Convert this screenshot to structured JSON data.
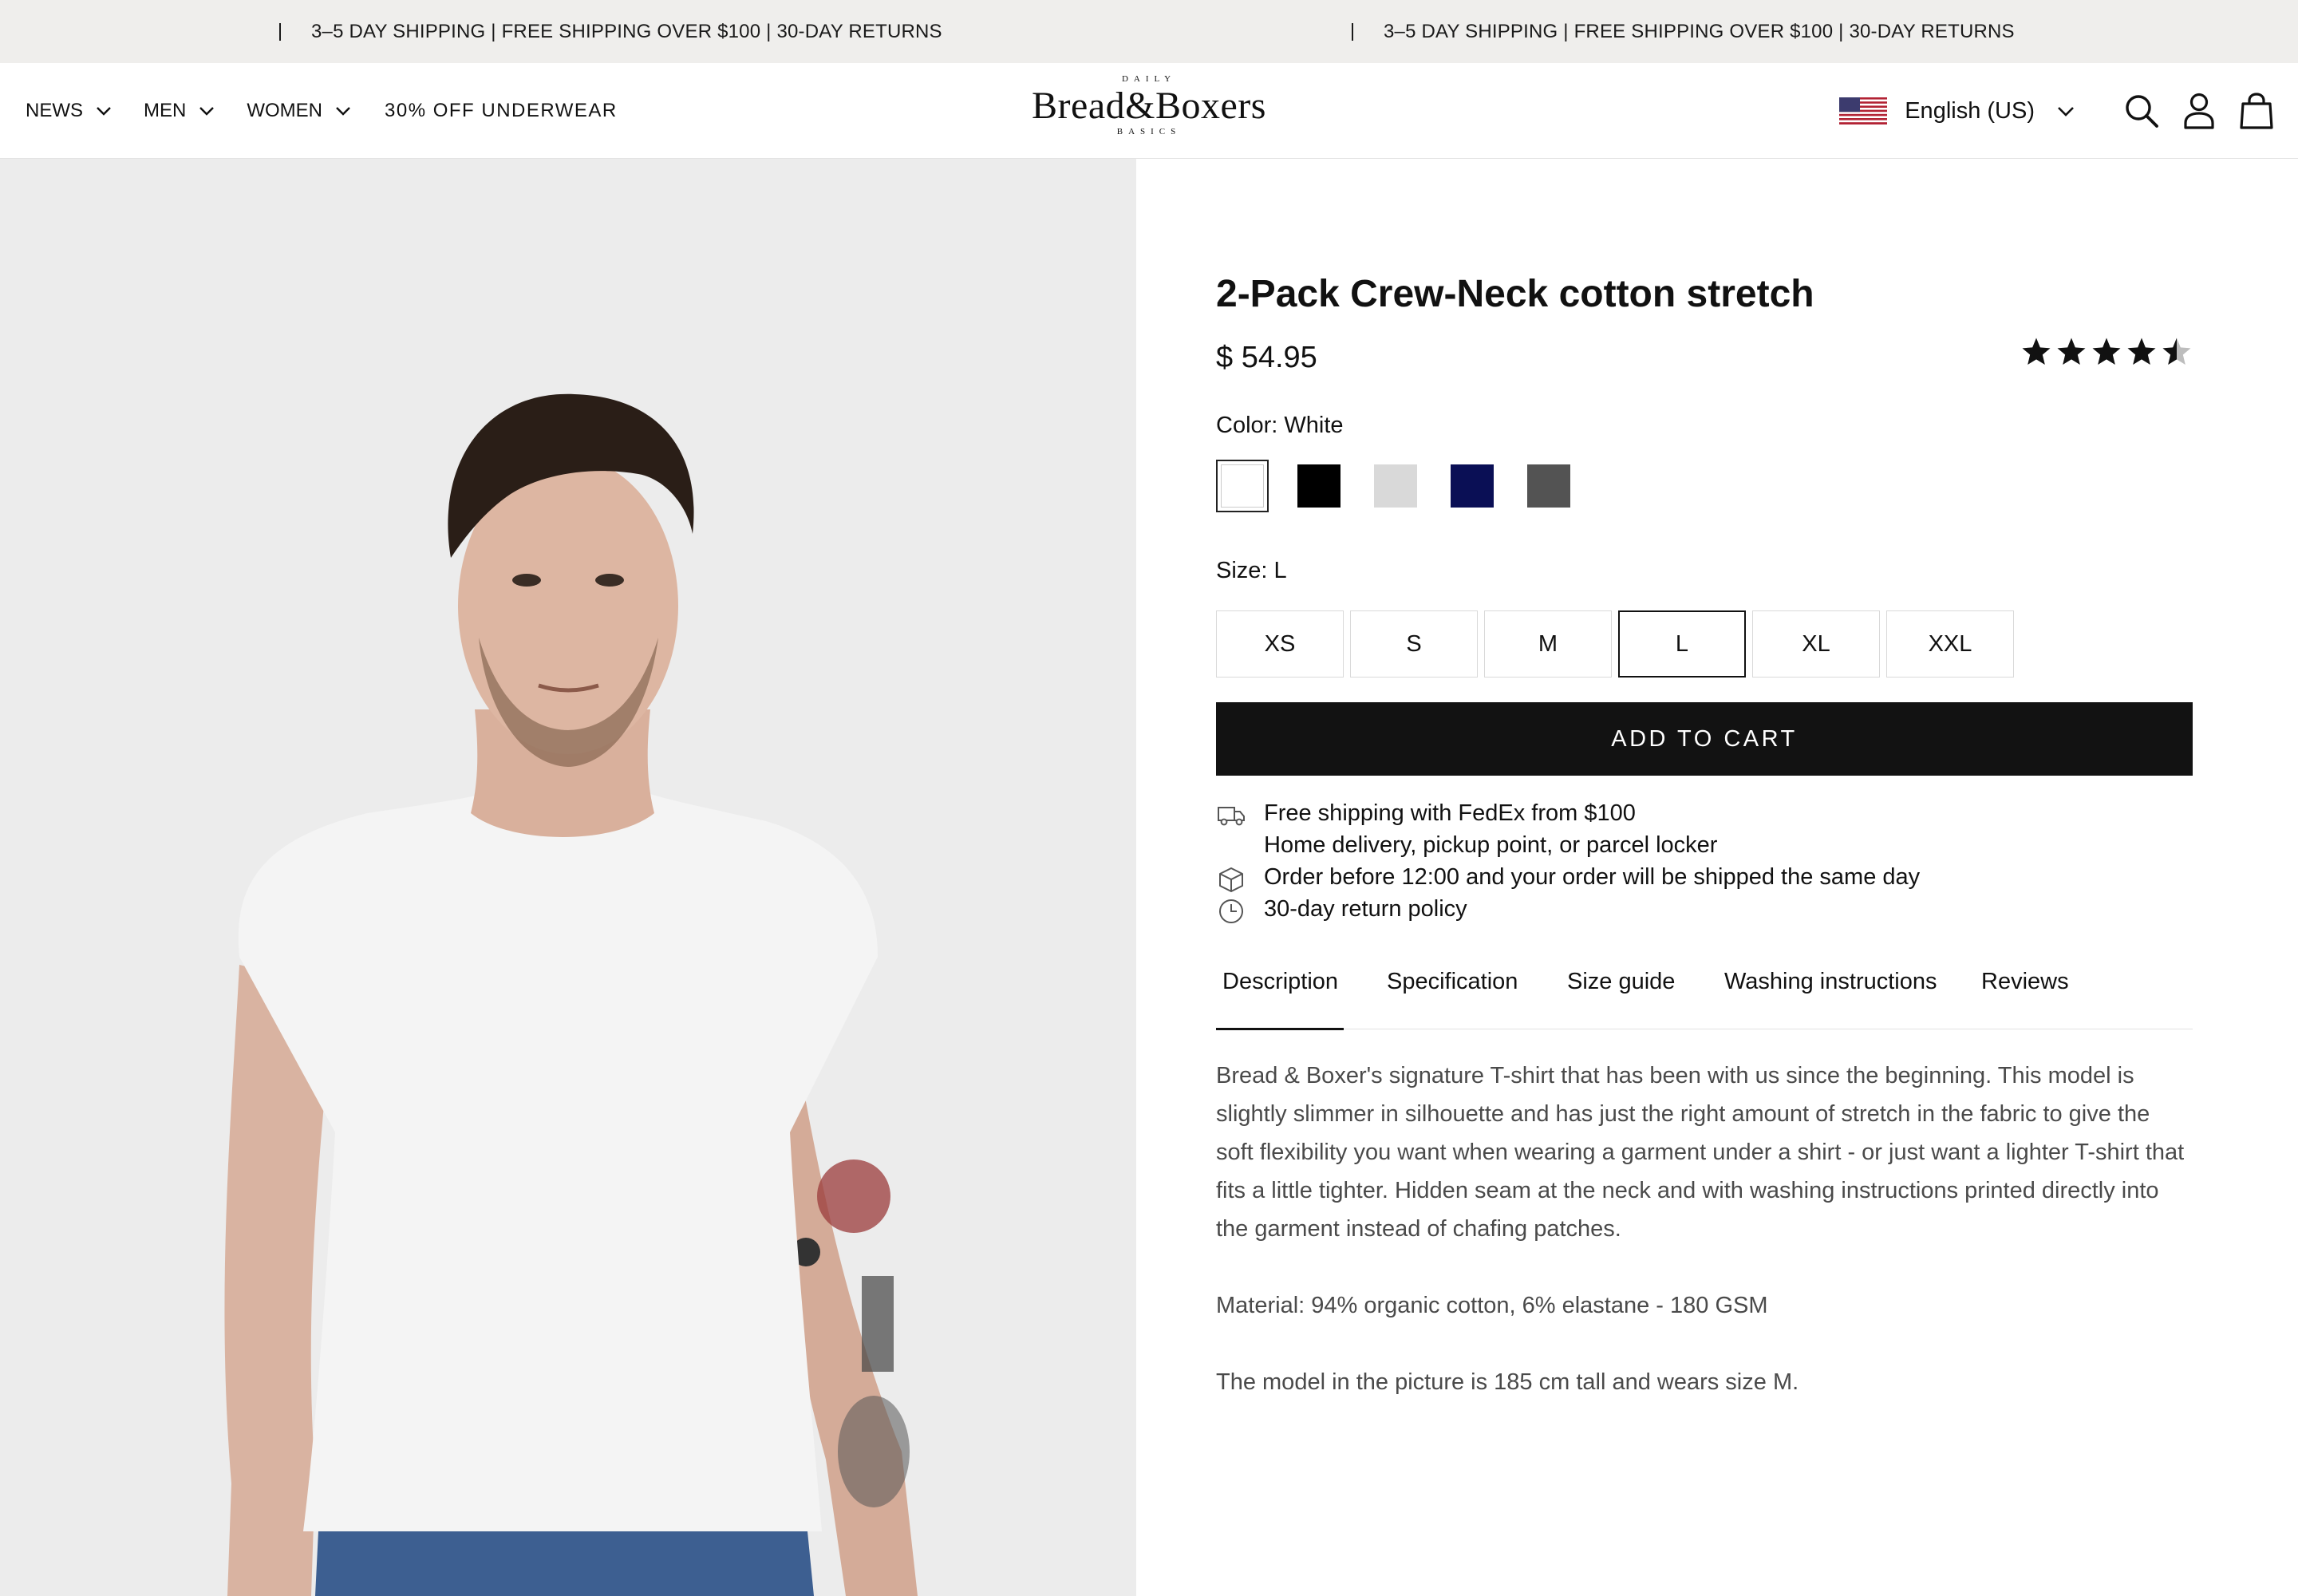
{
  "announcement": {
    "text": "3–5 DAY SHIPPING | FREE SHIPPING OVER $100 | 30-DAY RETURNS"
  },
  "nav": {
    "items": [
      {
        "label": "NEWS",
        "has_dropdown": true
      },
      {
        "label": "MEN",
        "has_dropdown": true
      },
      {
        "label": "WOMEN",
        "has_dropdown": true
      },
      {
        "label": "30% OFF UNDERWEAR",
        "has_dropdown": false
      }
    ]
  },
  "logo": {
    "top": "DAILY",
    "main": "Bread&Boxers",
    "bottom": "BASICS"
  },
  "header_right": {
    "language": "English (US)",
    "flag_icon": "us-flag-icon",
    "icons": [
      "search-icon",
      "account-icon",
      "bag-icon"
    ]
  },
  "product": {
    "title": "2-Pack Crew-Neck cotton stretch",
    "price": "$ 54.95",
    "rating": 4.5,
    "rating_max": 5,
    "color_label": "Color: White",
    "colors": [
      {
        "name": "White",
        "hex": "#ffffff",
        "selected": true
      },
      {
        "name": "Black",
        "hex": "#000000",
        "selected": false
      },
      {
        "name": "Light Grey",
        "hex": "#d9d9d9",
        "selected": false
      },
      {
        "name": "Navy",
        "hex": "#0a0f55",
        "selected": false
      },
      {
        "name": "Dark Grey",
        "hex": "#535353",
        "selected": false
      }
    ],
    "size_label": "Size: L",
    "sizes": [
      {
        "label": "XS",
        "selected": false
      },
      {
        "label": "S",
        "selected": false
      },
      {
        "label": "M",
        "selected": false
      },
      {
        "label": "L",
        "selected": true
      },
      {
        "label": "XL",
        "selected": false
      },
      {
        "label": "XXL",
        "selected": false
      }
    ],
    "add_to_cart": "ADD TO CART"
  },
  "perks": [
    {
      "icon": "truck-icon",
      "line1": "Free shipping with FedEx from $100",
      "line2": "Home delivery, pickup point, or parcel locker"
    },
    {
      "icon": "box-icon",
      "line1": "Order before 12:00 and your order will be shipped the same day"
    },
    {
      "icon": "clock-icon",
      "line1": "30-day return policy"
    }
  ],
  "tabs": [
    {
      "label": "Description",
      "active": true
    },
    {
      "label": "Specification",
      "active": false
    },
    {
      "label": "Size guide",
      "active": false
    },
    {
      "label": "Washing instructions",
      "active": false
    },
    {
      "label": "Reviews",
      "active": false
    }
  ],
  "description": {
    "paragraph1": "Bread & Boxer's signature T-shirt that has been with us since the beginning. This model is slightly slimmer in silhouette and has just the right amount of stretch in the fabric to give the soft flexibility you want when wearing a garment under a shirt - or just want a lighter T-shirt that fits a little tighter. Hidden seam at the neck and with washing instructions printed directly into the garment instead of chafing patches.",
    "paragraph2": "Material: 94% organic cotton, 6% elastane - 180 GSM",
    "paragraph3": "The model in the picture is 185 cm tall and wears size M."
  },
  "colors": {
    "announcement_bg": "#efeeec",
    "hero_bg": "#ececec",
    "cta_bg": "#121212",
    "text": "#111111",
    "body_text": "#4a4a4a"
  }
}
